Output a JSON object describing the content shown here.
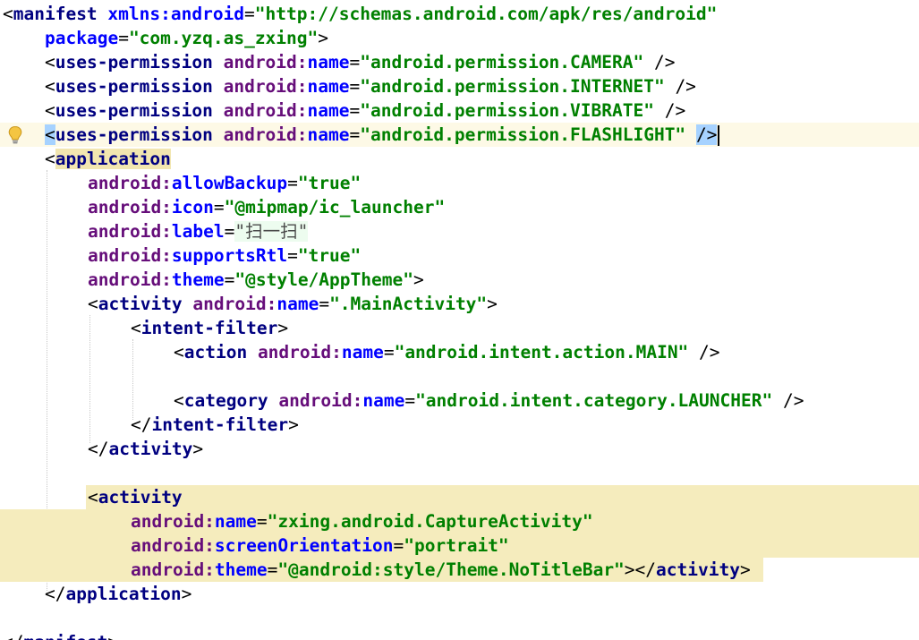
{
  "lines": [
    {
      "id": 0,
      "parts": [
        {
          "c": "p",
          "t": "<"
        },
        {
          "c": "t",
          "t": "manifest "
        },
        {
          "c": "a",
          "t": "xmlns:android"
        },
        {
          "c": "p",
          "t": "="
        },
        {
          "c": "v",
          "t": "\"http://schemas.android.com/apk/res/android\""
        }
      ]
    },
    {
      "id": 1,
      "parts": [
        {
          "c": "a",
          "t": "package"
        },
        {
          "c": "p",
          "t": "="
        },
        {
          "c": "v",
          "t": "\"com.yzq.as_zxing\""
        },
        {
          "c": "p",
          "t": ">"
        }
      ]
    },
    {
      "id": 2,
      "parts": [
        {
          "c": "p",
          "t": "<"
        },
        {
          "c": "t",
          "t": "uses-permission "
        },
        {
          "c": "ns",
          "t": "android:"
        },
        {
          "c": "a",
          "t": "name"
        },
        {
          "c": "p",
          "t": "="
        },
        {
          "c": "v",
          "t": "\"android.permission.CAMERA\""
        },
        {
          "c": "p",
          "t": " />"
        }
      ]
    },
    {
      "id": 3,
      "parts": [
        {
          "c": "p",
          "t": "<"
        },
        {
          "c": "t",
          "t": "uses-permission "
        },
        {
          "c": "ns",
          "t": "android:"
        },
        {
          "c": "a",
          "t": "name"
        },
        {
          "c": "p",
          "t": "="
        },
        {
          "c": "v",
          "t": "\"android.permission.INTERNET\""
        },
        {
          "c": "p",
          "t": " />"
        }
      ]
    },
    {
      "id": 4,
      "parts": [
        {
          "c": "p",
          "t": "<"
        },
        {
          "c": "t",
          "t": "uses-permission "
        },
        {
          "c": "ns",
          "t": "android:"
        },
        {
          "c": "a",
          "t": "name"
        },
        {
          "c": "p",
          "t": "="
        },
        {
          "c": "v",
          "t": "\"android.permission.VIBRATE\""
        },
        {
          "c": "p",
          "t": " />"
        }
      ]
    },
    {
      "id": 5,
      "parts": [
        {
          "c": "p hl-match",
          "t": "<"
        },
        {
          "c": "t",
          "t": "uses-permission "
        },
        {
          "c": "ns",
          "t": "android:"
        },
        {
          "c": "a",
          "t": "name"
        },
        {
          "c": "p",
          "t": "="
        },
        {
          "c": "v",
          "t": "\"android.permission.FLASHLIGHT\""
        },
        {
          "c": "p",
          "t": " "
        },
        {
          "c": "p hl-match",
          "t": "/>"
        }
      ]
    },
    {
      "id": 6,
      "parts": [
        {
          "c": "p",
          "t": "<"
        },
        {
          "c": "t hl-tag",
          "t": "application"
        }
      ]
    },
    {
      "id": 7,
      "parts": [
        {
          "c": "ns",
          "t": "android:"
        },
        {
          "c": "a",
          "t": "allowBackup"
        },
        {
          "c": "p",
          "t": "="
        },
        {
          "c": "v",
          "t": "\"true\""
        }
      ]
    },
    {
      "id": 8,
      "parts": [
        {
          "c": "ns",
          "t": "android:"
        },
        {
          "c": "a",
          "t": "icon"
        },
        {
          "c": "p",
          "t": "="
        },
        {
          "c": "v",
          "t": "\"@mipmap/ic_launcher\""
        }
      ]
    },
    {
      "id": 9,
      "parts": [
        {
          "c": "ns",
          "t": "android:"
        },
        {
          "c": "a",
          "t": "label"
        },
        {
          "c": "p",
          "t": "="
        },
        {
          "c": "hl-label",
          "t": "\"扫一扫\""
        }
      ]
    },
    {
      "id": 10,
      "parts": [
        {
          "c": "ns",
          "t": "android:"
        },
        {
          "c": "a",
          "t": "supportsRtl"
        },
        {
          "c": "p",
          "t": "="
        },
        {
          "c": "v",
          "t": "\"true\""
        }
      ]
    },
    {
      "id": 11,
      "parts": [
        {
          "c": "ns",
          "t": "android:"
        },
        {
          "c": "a",
          "t": "theme"
        },
        {
          "c": "p",
          "t": "="
        },
        {
          "c": "v",
          "t": "\"@style/AppTheme\""
        },
        {
          "c": "p",
          "t": ">"
        }
      ]
    },
    {
      "id": 12,
      "parts": [
        {
          "c": "p",
          "t": "<"
        },
        {
          "c": "t",
          "t": "activity "
        },
        {
          "c": "ns",
          "t": "android:"
        },
        {
          "c": "a",
          "t": "name"
        },
        {
          "c": "p",
          "t": "="
        },
        {
          "c": "v",
          "t": "\".MainActivity\""
        },
        {
          "c": "p",
          "t": ">"
        }
      ]
    },
    {
      "id": 13,
      "parts": [
        {
          "c": "p",
          "t": "<"
        },
        {
          "c": "t",
          "t": "intent-filter"
        },
        {
          "c": "p",
          "t": ">"
        }
      ]
    },
    {
      "id": 14,
      "parts": [
        {
          "c": "p",
          "t": "<"
        },
        {
          "c": "t",
          "t": "action "
        },
        {
          "c": "ns",
          "t": "android:"
        },
        {
          "c": "a",
          "t": "name"
        },
        {
          "c": "p",
          "t": "="
        },
        {
          "c": "v",
          "t": "\"android.intent.action.MAIN\""
        },
        {
          "c": "p",
          "t": " />"
        }
      ]
    },
    {
      "id": 15,
      "parts": [
        {
          "c": "p",
          "t": "<"
        },
        {
          "c": "t",
          "t": "category "
        },
        {
          "c": "ns",
          "t": "android:"
        },
        {
          "c": "a",
          "t": "name"
        },
        {
          "c": "p",
          "t": "="
        },
        {
          "c": "v",
          "t": "\"android.intent.category.LAUNCHER\""
        },
        {
          "c": "p",
          "t": " />"
        }
      ]
    },
    {
      "id": 16,
      "parts": [
        {
          "c": "p",
          "t": "</"
        },
        {
          "c": "t",
          "t": "intent-filter"
        },
        {
          "c": "p",
          "t": ">"
        }
      ]
    },
    {
      "id": 17,
      "parts": [
        {
          "c": "p",
          "t": "</"
        },
        {
          "c": "t",
          "t": "activity"
        },
        {
          "c": "p",
          "t": ">"
        }
      ]
    },
    {
      "id": 18,
      "parts": [
        {
          "c": "p",
          "t": "<"
        },
        {
          "c": "t",
          "t": "activity"
        }
      ]
    },
    {
      "id": 19,
      "parts": [
        {
          "c": "ns",
          "t": "android:"
        },
        {
          "c": "a",
          "t": "name"
        },
        {
          "c": "p",
          "t": "="
        },
        {
          "c": "v",
          "t": "\"zxing.android.CaptureActivity\""
        }
      ]
    },
    {
      "id": 20,
      "parts": [
        {
          "c": "ns",
          "t": "android:"
        },
        {
          "c": "a",
          "t": "screenOrientation"
        },
        {
          "c": "p",
          "t": "="
        },
        {
          "c": "v",
          "t": "\"portrait\""
        }
      ]
    },
    {
      "id": 21,
      "parts": [
        {
          "c": "ns",
          "t": "android:"
        },
        {
          "c": "a",
          "t": "theme"
        },
        {
          "c": "p",
          "t": "="
        },
        {
          "c": "v",
          "t": "\"@android:style/Theme.NoTitleBar\""
        },
        {
          "c": "p",
          "t": "></"
        },
        {
          "c": "t",
          "t": "activity"
        },
        {
          "c": "p",
          "t": ">"
        }
      ]
    },
    {
      "id": 22,
      "parts": [
        {
          "c": "p",
          "t": "</"
        },
        {
          "c": "t",
          "t": "application"
        },
        {
          "c": "p",
          "t": ">"
        }
      ]
    },
    {
      "id": 23,
      "parts": [
        {
          "c": "p",
          "t": "</"
        },
        {
          "c": "t",
          "t": "manifest"
        },
        {
          "c": "p",
          "t": ">"
        }
      ]
    }
  ],
  "gutter": {
    "intention_icon": "lightbulb-icon"
  },
  "colors": {
    "tag": "#000080",
    "attribute": "#0000ff",
    "namespace": "#660e7a",
    "value": "#008000",
    "caret_row": "#fdf9e6",
    "selection": "#f5ecbd"
  }
}
